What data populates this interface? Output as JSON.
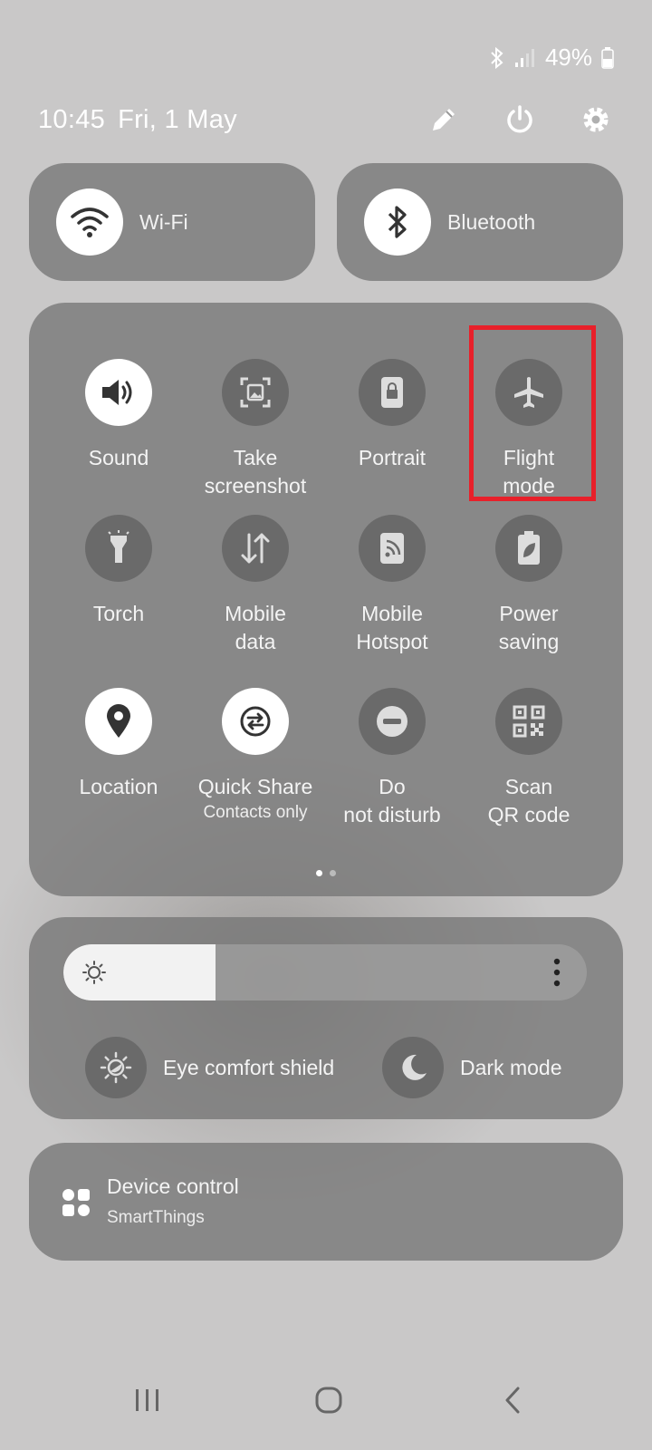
{
  "status": {
    "battery": "49%",
    "icons": [
      "bluetooth-icon",
      "signal-icon",
      "battery-icon"
    ]
  },
  "header": {
    "time": "10:45",
    "date": "Fri, 1 May",
    "actions": [
      "edit-icon",
      "power-icon",
      "settings-icon"
    ]
  },
  "connections": {
    "wifi": "Wi-Fi",
    "bluetooth": "Bluetooth"
  },
  "tiles": [
    {
      "label": "Sound",
      "icon": "sound-icon",
      "on": true
    },
    {
      "label": "Take screenshot",
      "icon": "screenshot-icon",
      "on": false
    },
    {
      "label": "Portrait",
      "icon": "portrait-lock-icon",
      "on": false
    },
    {
      "label": "Flight mode",
      "icon": "airplane-icon",
      "on": false
    },
    {
      "label": "Torch",
      "icon": "torch-icon",
      "on": false
    },
    {
      "label": "Mobile data",
      "icon": "mobile-data-icon",
      "on": false
    },
    {
      "label": "Mobile Hotspot",
      "icon": "hotspot-icon",
      "on": false
    },
    {
      "label": "Power saving",
      "icon": "power-saving-icon",
      "on": false
    },
    {
      "label": "Location",
      "icon": "location-icon",
      "on": true
    },
    {
      "label": "Quick Share",
      "sublabel": "Contacts only",
      "icon": "quick-share-icon",
      "on": true
    },
    {
      "label": "Do not disturb",
      "icon": "do-not-disturb-icon",
      "on": false
    },
    {
      "label": "Scan QR code",
      "icon": "qr-code-icon",
      "on": false
    }
  ],
  "pager": {
    "pages": 2,
    "current": 1
  },
  "brightness": {
    "level": 0.29
  },
  "display_toggles": {
    "eye_comfort": "Eye comfort shield",
    "dark_mode": "Dark mode"
  },
  "device_control": {
    "title": "Device control",
    "subtitle": "SmartThings"
  },
  "colors": {
    "highlight": "#e8202a",
    "card": "#767676",
    "tile_off": "#6a6a6a",
    "tile_on": "#ffffff"
  }
}
